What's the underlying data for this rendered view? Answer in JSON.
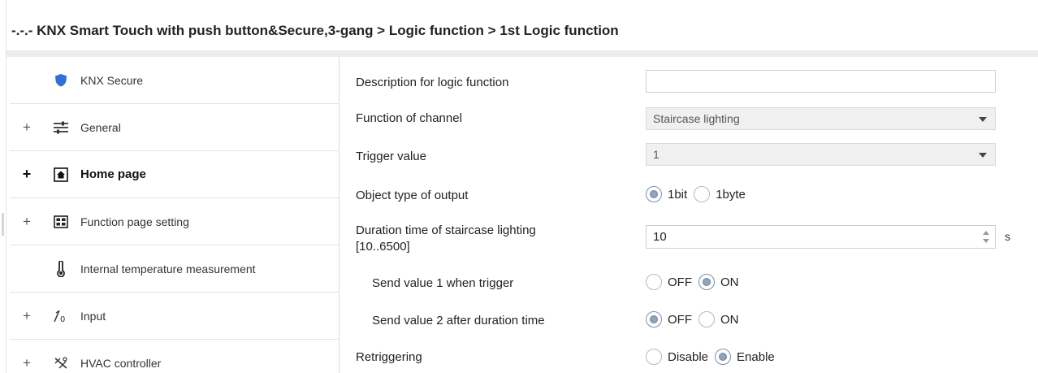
{
  "header": {
    "title": "-.-.- KNX Smart Touch with push button&Secure,3-gang > Logic function > 1st Logic function"
  },
  "sidebar": {
    "items": [
      {
        "expander": "",
        "icon": "shield-icon",
        "label": "KNX Secure",
        "bold": false
      },
      {
        "expander": "+",
        "icon": "sliders-icon",
        "label": "General",
        "bold": false
      },
      {
        "expander": "+",
        "icon": "home-icon",
        "label": "Home page",
        "bold": true
      },
      {
        "expander": "+",
        "icon": "grid-icon",
        "label": "Function page setting",
        "bold": false
      },
      {
        "expander": "",
        "icon": "thermometer-icon",
        "label": "Internal temperature measurement",
        "bold": false
      },
      {
        "expander": "+",
        "icon": "input-icon",
        "label": "Input",
        "bold": false
      },
      {
        "expander": "+",
        "icon": "hvac-icon",
        "label": "HVAC controller",
        "bold": false
      }
    ]
  },
  "params": {
    "description": {
      "label": "Description for logic function",
      "value": ""
    },
    "function_of_channel": {
      "label": "Function of channel",
      "value": "Staircase lighting"
    },
    "trigger_value": {
      "label": "Trigger value",
      "value": "1"
    },
    "object_type": {
      "label": "Object type of  output",
      "options": [
        "1bit",
        "1byte"
      ],
      "selected": "1bit"
    },
    "duration": {
      "label_line1": "Duration time of staircase lighting",
      "label_line2": "[10..6500]",
      "value": "10",
      "unit": "s"
    },
    "send_value_1": {
      "label": "Send value 1 when trigger",
      "options": [
        "OFF",
        "ON"
      ],
      "selected": "ON"
    },
    "send_value_2": {
      "label": "Send value 2 after duration time",
      "options": [
        "OFF",
        "ON"
      ],
      "selected": "OFF"
    },
    "retriggering": {
      "label": "Retriggering",
      "options": [
        "Disable",
        "Enable"
      ],
      "selected": "Enable"
    }
  },
  "colors": {
    "shield": "#2f6fd6",
    "radio_selected": "#8fa3bb",
    "header_band": "#ededed",
    "select_bg": "#f0f0f0"
  }
}
